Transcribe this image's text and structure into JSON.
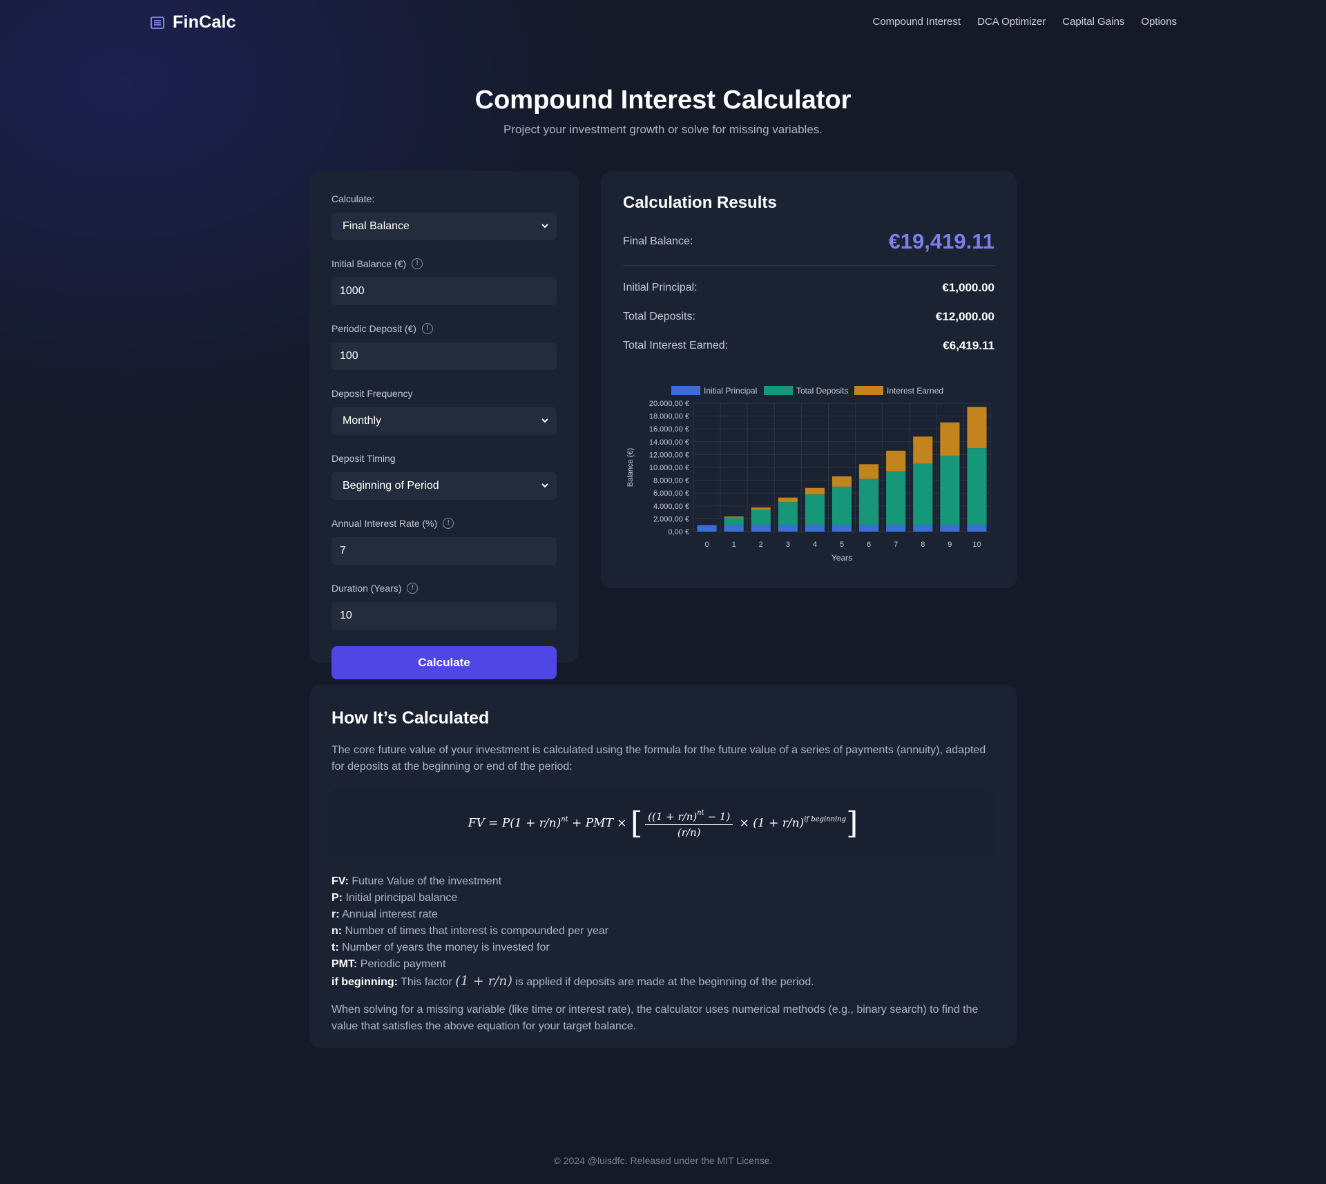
{
  "brand": {
    "name": "FinCalc",
    "icon": "list-icon"
  },
  "nav": [
    "Compound Interest",
    "DCA Optimizer",
    "Capital Gains",
    "Options"
  ],
  "hero": {
    "title": "Compound Interest Calculator",
    "subtitle": "Project your investment growth or solve for missing variables."
  },
  "form": {
    "calculate_label": "Calculate:",
    "calculate_value": "Final Balance",
    "initial_label": "Initial Balance (€)",
    "initial_value": "1000",
    "deposit_label": "Periodic Deposit (€)",
    "deposit_value": "100",
    "frequency_label": "Deposit Frequency",
    "frequency_value": "Monthly",
    "timing_label": "Deposit Timing",
    "timing_value": "Beginning of Period",
    "rate_label": "Annual Interest Rate (%)",
    "rate_value": "7",
    "duration_label": "Duration (Years)",
    "duration_value": "10",
    "button": "Calculate"
  },
  "results": {
    "title": "Calculation Results",
    "final_label": "Final Balance:",
    "final_value": "€19,419.11",
    "principal_label": "Initial Principal:",
    "principal_value": "€1,000.00",
    "deposits_label": "Total Deposits:",
    "deposits_value": "€12,000.00",
    "interest_label": "Total Interest Earned:",
    "interest_value": "€6,419.11"
  },
  "chart_data": {
    "type": "bar",
    "stacked": true,
    "categories": [
      "0",
      "1",
      "2",
      "3",
      "4",
      "5",
      "6",
      "7",
      "8",
      "9",
      "10"
    ],
    "series": [
      {
        "name": "Initial Principal",
        "color": "#3b6fd8",
        "values": [
          1000,
          1000,
          1000,
          1000,
          1000,
          1000,
          1000,
          1000,
          1000,
          1000,
          1000
        ]
      },
      {
        "name": "Total Deposits",
        "color": "#17977a",
        "values": [
          0,
          1200,
          2400,
          3600,
          4800,
          6000,
          7200,
          8400,
          9600,
          10800,
          12000
        ]
      },
      {
        "name": "Interest Earned",
        "color": "#c4841d",
        "values": [
          0,
          150,
          350,
          700,
          1000,
          1600,
          2300,
          3200,
          4200,
          5200,
          6419.11
        ]
      }
    ],
    "xlabel": "Years",
    "ylabel": "Balance (€)",
    "ylim": [
      0,
      20000
    ],
    "yticks": [
      "0,00 €",
      "2.000,00 €",
      "4.000,00 €",
      "6.000,00 €",
      "8.000,00 €",
      "10.000,00 €",
      "12.000,00 €",
      "14.000,00 €",
      "16.000,00 €",
      "18.000,00 €",
      "20.000,00 €"
    ],
    "grid": true,
    "legend": "top"
  },
  "explain": {
    "title": "How It’s Calculated",
    "intro": "The core future value of your investment is calculated using the formula for the future value of a series of payments (annuity), adapted for deposits at the beginning or end of the period:",
    "defs": [
      {
        "term": "FV:",
        "text": " Future Value of the investment"
      },
      {
        "term": "P:",
        "text": " Initial principal balance"
      },
      {
        "term": "r:",
        "text": " Annual interest rate"
      },
      {
        "term": "n:",
        "text": " Number of times that interest is compounded per year"
      },
      {
        "term": "t:",
        "text": " Number of years the money is invested for"
      },
      {
        "term": "PMT:",
        "text": " Periodic payment"
      }
    ],
    "beginning_term": "if beginning:",
    "beginning_pre": " This factor ",
    "beginning_math": "(1 + r/n)",
    "beginning_post": " is applied if deposits are made at the beginning of the period.",
    "outro": "When solving for a missing variable (like time or interest rate), the calculator uses numerical methods (e.g., binary search) to find the value that satisfies the above equation for your target balance."
  },
  "formula": {
    "lhs": "FV = P(1 + r/n)",
    "exp1": "nt",
    "mid": " + PMT × ",
    "num": "((1 + r/n)",
    "num_exp": "nt",
    "num_end": " − 1)",
    "den": "(r/n)",
    "tail": " × (1 + r/n)",
    "tail_exp": "if beginning"
  },
  "footer": "© 2024 @luisdfc. Released under the MIT License."
}
